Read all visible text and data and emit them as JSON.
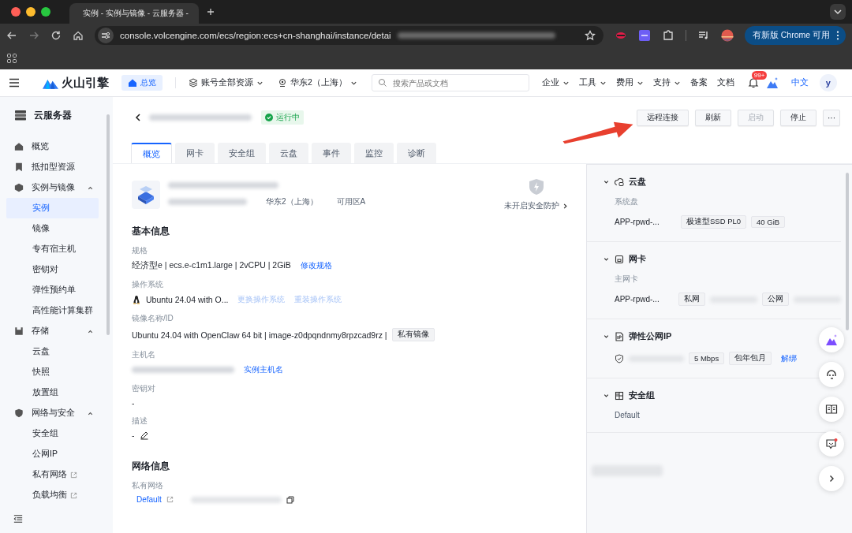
{
  "browser": {
    "tab_title": "实例 - 实例与镜像 - 云服务器 -",
    "url": "console.volcengine.com/ecs/region:ecs+cn-shanghai/instance/detai",
    "update_button": "有新版 Chrome 可用"
  },
  "header": {
    "logo": "火山引擎",
    "home": "总览",
    "scope": "账号全部资源",
    "region": "华东2（上海）",
    "search": {
      "placeholder": "搜索产品或文档"
    },
    "nav": [
      {
        "label": "企业",
        "dropdown": true
      },
      {
        "label": "工具",
        "dropdown": true
      },
      {
        "label": "费用",
        "dropdown": true
      },
      {
        "label": "支持",
        "dropdown": true
      },
      {
        "label": "备案",
        "dropdown": false
      },
      {
        "label": "文档",
        "dropdown": false
      }
    ],
    "badge": "99+",
    "language": "中文",
    "avatar": "y"
  },
  "sidebar": {
    "title": "云服务器",
    "items": [
      {
        "label": "概览",
        "selected": false
      },
      {
        "label": "抵扣型资源",
        "selected": false
      },
      {
        "label": "实例与镜像",
        "selected": false,
        "expanded": true,
        "children": [
          {
            "label": "实例",
            "selected": true,
            "external": false
          },
          {
            "label": "镜像",
            "selected": false,
            "external": false
          },
          {
            "label": "专有宿主机",
            "selected": false,
            "external": false
          },
          {
            "label": "密钥对",
            "selected": false,
            "external": false
          },
          {
            "label": "弹性预约单",
            "selected": false,
            "external": false
          },
          {
            "label": "高性能计算集群",
            "selected": false,
            "external": false
          }
        ]
      },
      {
        "label": "存储",
        "selected": false,
        "expanded": true,
        "children": [
          {
            "label": "云盘",
            "selected": false,
            "external": false
          },
          {
            "label": "快照",
            "selected": false,
            "external": false
          },
          {
            "label": "放置组",
            "selected": false,
            "external": false
          }
        ]
      },
      {
        "label": "网络与安全",
        "selected": false,
        "expanded": true,
        "children": [
          {
            "label": "安全组",
            "selected": false,
            "external": false
          },
          {
            "label": "公网IP",
            "selected": false,
            "external": false
          },
          {
            "label": "私有网络",
            "selected": false,
            "external": true
          },
          {
            "label": "负载均衡",
            "selected": false,
            "external": true
          }
        ]
      }
    ]
  },
  "instance": {
    "status": "运行中",
    "region": "华东2（上海）",
    "zone": "可用区A",
    "security": "未开启安全防护"
  },
  "actions": [
    {
      "label": "远程连接",
      "disabled": false
    },
    {
      "label": "刷新",
      "disabled": false
    },
    {
      "label": "启动",
      "disabled": true
    },
    {
      "label": "停止",
      "disabled": false
    }
  ],
  "more": "···",
  "tabs": [
    {
      "label": "概览",
      "selected": true
    },
    {
      "label": "网卡",
      "selected": false
    },
    {
      "label": "安全组",
      "selected": false
    },
    {
      "label": "云盘",
      "selected": false
    },
    {
      "label": "事件",
      "selected": false
    },
    {
      "label": "监控",
      "selected": false
    },
    {
      "label": "诊断",
      "selected": false
    }
  ],
  "basic": {
    "title": "基本信息",
    "fields": [
      {
        "label": "规格",
        "kind": "text",
        "value": "经济型e | ecs.e-c1m1.large | 2vCPU | 2GiB",
        "links": [
          {
            "label": "修改规格",
            "disabled": false
          }
        ]
      },
      {
        "label": "操作系统",
        "kind": "os",
        "value": "Ubuntu 24.04 with O...",
        "links": [
          {
            "label": "更换操作系统",
            "disabled": true
          },
          {
            "label": "重装操作系统",
            "disabled": true
          }
        ]
      },
      {
        "label": "镜像名称/ID",
        "kind": "text",
        "value": "Ubuntu 24.04 with OpenClaw 64 bit | image-z0dpqndnmy8rpzcad9rz |",
        "tag": "私有镜像"
      },
      {
        "label": "主机名",
        "kind": "redacted",
        "links": [
          {
            "label": "实例主机名",
            "disabled": false
          }
        ]
      },
      {
        "label": "密钥对",
        "kind": "text",
        "value": "-"
      },
      {
        "label": "描述",
        "kind": "editable",
        "value": "-"
      }
    ]
  },
  "network": {
    "title": "网络信息",
    "label": "私有网络",
    "link": "Default"
  },
  "panels": [
    {
      "kind": "disk",
      "title": "云盘",
      "expanded": true,
      "sublabel": "系统盘",
      "name": "APP-rpwd-...",
      "tags": [
        "极速型SSD PL0",
        "40 GiB"
      ]
    },
    {
      "kind": "nic",
      "title": "网卡",
      "expanded": true,
      "sublabel": "主网卡",
      "name": "APP-rpwd-...",
      "tags": [
        "私网",
        "公网"
      ]
    },
    {
      "kind": "eip",
      "title": "弹性公网IP",
      "expanded": true,
      "tags": [
        "5 Mbps",
        "包年包月"
      ],
      "link": "解绑"
    },
    {
      "kind": "sg",
      "title": "安全组",
      "expanded": true,
      "value": "Default"
    }
  ]
}
